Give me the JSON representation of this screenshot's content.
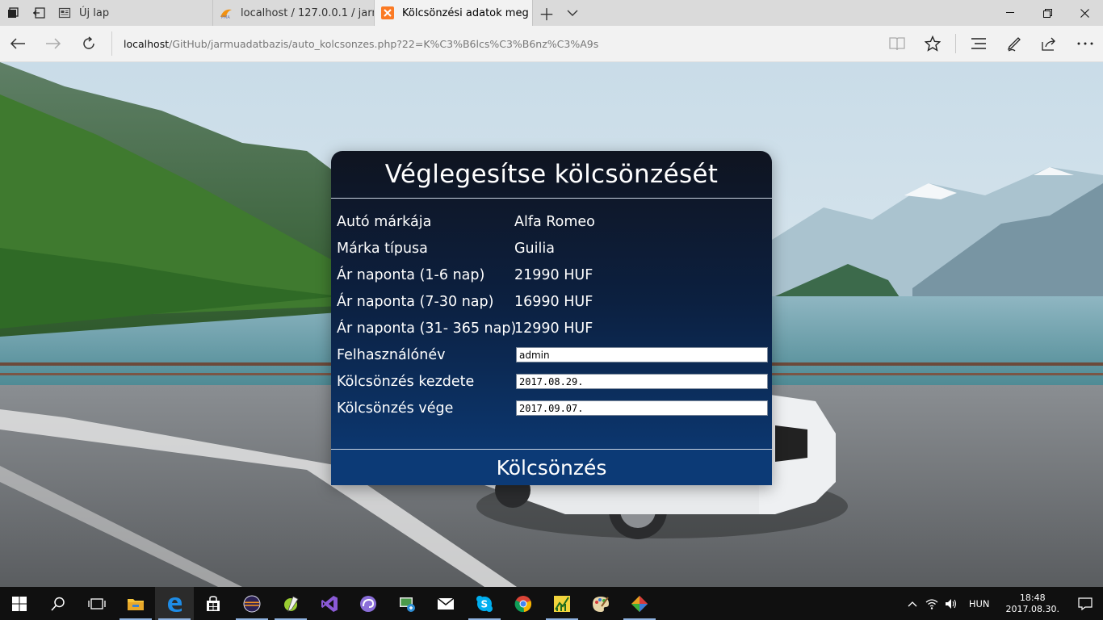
{
  "browser": {
    "tabs": [
      {
        "label": "Új lap",
        "active": false
      },
      {
        "label": "localhost / 127.0.0.1 / jarmu",
        "active": false
      },
      {
        "label": "Kölcsönzési adatok meg",
        "active": true
      }
    ],
    "url_host": "localhost",
    "url_path": "/GitHub/jarmuadatbazis/auto_kolcsonzes.php?22=K%C3%B6lcs%C3%B6nz%C3%A9s"
  },
  "card": {
    "title": "Véglegesítse kölcsönzését",
    "fields": [
      {
        "label": "Autó márkája",
        "value": "Alfa Romeo"
      },
      {
        "label": "Márka típusa",
        "value": "Guilia"
      },
      {
        "label": "Ár naponta (1-6 nap)",
        "value": "21990 HUF"
      },
      {
        "label": "Ár naponta (7-30 nap)",
        "value": "16990 HUF"
      },
      {
        "label": "Ár naponta (31- 365 nap)",
        "value": "12990 HUF"
      }
    ],
    "inputs": [
      {
        "label": "Felhasználónév",
        "value": "admin"
      },
      {
        "label": "Kölcsönzés kezdete",
        "value": "2017.08.29."
      },
      {
        "label": "Kölcsönzés vége",
        "value": "2017.09.07."
      }
    ],
    "submit_label": "Kölcsönzés"
  },
  "taskbar": {
    "language": "HUN",
    "time": "18:48",
    "date": "2017.08.30."
  },
  "colors": {
    "card_top": "#0f1420",
    "card_bottom": "#0c3c7a",
    "taskbar": "#101010",
    "tab_bar": "#dadada"
  }
}
